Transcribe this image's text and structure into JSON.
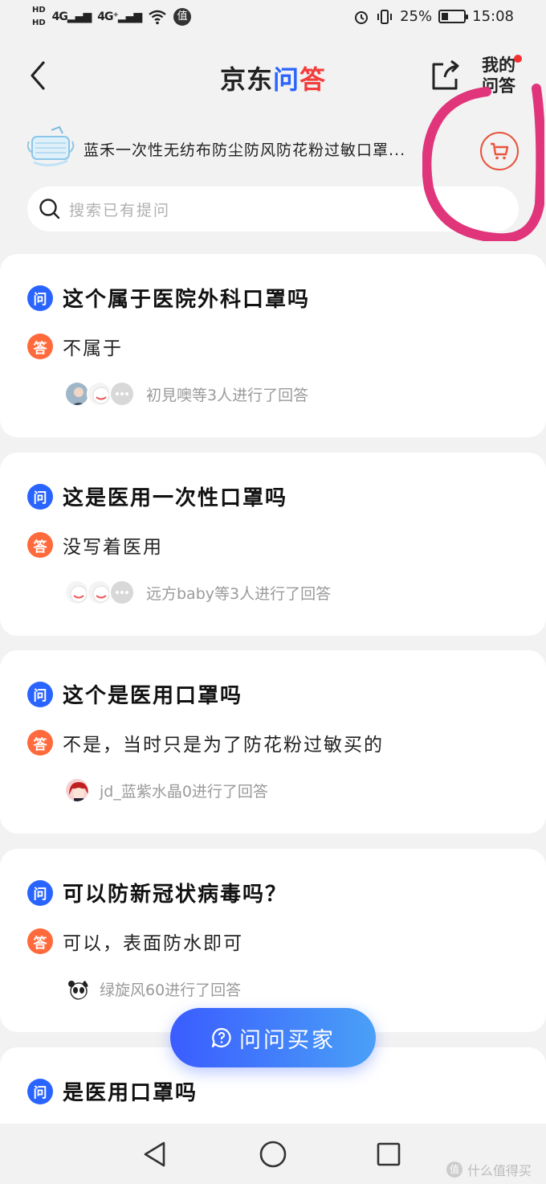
{
  "status_bar": {
    "hd1": "HD",
    "hd2": "HD",
    "net1": "4G",
    "net2": "4G⁺",
    "value_icon": "值",
    "battery": "25%",
    "time": "15:08"
  },
  "header": {
    "logo_part1": "京东",
    "logo_part2": "问",
    "logo_part3": "答",
    "my_qa": "我的问答"
  },
  "product": {
    "title": "蓝禾一次性无纺布防尘防风防花粉过敏口罩..."
  },
  "search": {
    "placeholder": "搜索已有提问"
  },
  "badges": {
    "question": "问",
    "answer": "答"
  },
  "qa_items": [
    {
      "question": "这个属于医院外科口罩吗",
      "answer": "不属于",
      "responders": "初見噢等3人进行了回答"
    },
    {
      "question": "这是医用一次性口罩吗",
      "answer": "没写着医用",
      "responders": "远方baby等3人进行了回答"
    },
    {
      "question": "这个是医用口罩吗",
      "answer": "不是，当时只是为了防花粉过敏买的",
      "responders": "jd_蓝紫水晶0进行了回答"
    },
    {
      "question": "可以防新冠状病毒吗？",
      "answer": "可以，表面防水即可",
      "responders": "绿旋风60进行了回答"
    },
    {
      "question": "是医用口罩吗"
    }
  ],
  "ask_button": {
    "label": "问问买家"
  },
  "watermark": {
    "text": "什么值得买",
    "icon": "值"
  },
  "colors": {
    "brand_blue": "#2a64ff",
    "answer_orange": "#ff6a3d",
    "annotation_pink": "#e0357a"
  }
}
